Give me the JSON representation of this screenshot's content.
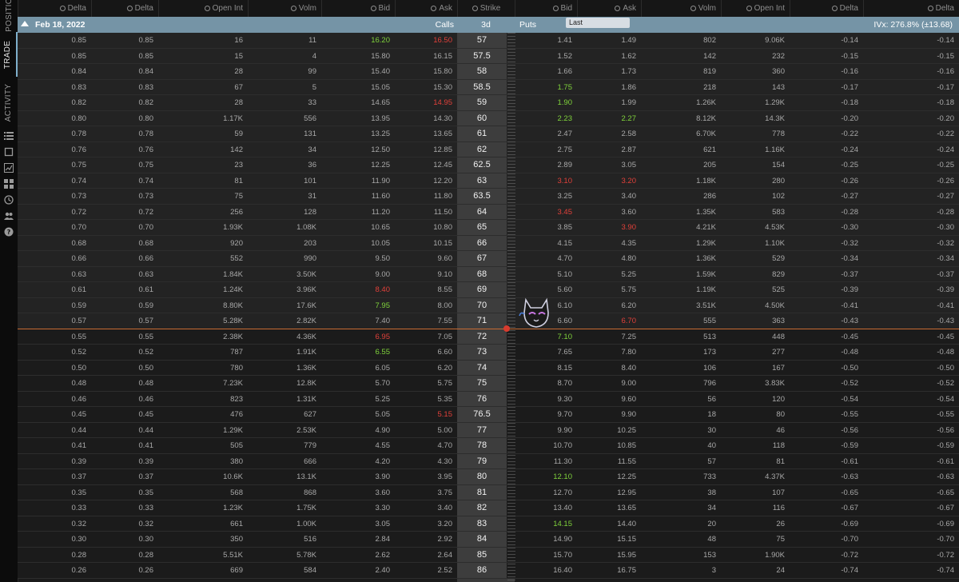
{
  "left_rail": {
    "tabs": [
      {
        "label": "POSITIO",
        "active": false
      },
      {
        "label": "TRADE",
        "active": true
      },
      {
        "label": "ACTIVITY",
        "active": false
      }
    ],
    "icons": [
      "list-icon",
      "square-icon",
      "chart-icon",
      "grid-icon",
      "clock-icon",
      "people-icon",
      "help-icon"
    ]
  },
  "header": {
    "call_columns": [
      "Delta",
      "Delta",
      "Open Int",
      "Volm",
      "Bid",
      "Ask"
    ],
    "strike_column": "Strike",
    "put_columns": [
      "Bid",
      "Ask",
      "Volm",
      "Open Int",
      "Delta",
      "Delta"
    ]
  },
  "series": {
    "date": "Feb 18, 2022",
    "calls_label": "Calls",
    "days_label": "3d",
    "puts_label": "Puts",
    "tooltip": "Last",
    "ivx": "IVx: 276.8% (±13.68)"
  },
  "colors": {
    "up": "#7fd23b",
    "down": "#e0403a",
    "series_bar": "#7594a6",
    "price_line": "#c86b33"
  },
  "rows": [
    {
      "call": [
        "0.85",
        "0.85",
        "16",
        "11",
        "16.20",
        "16.50"
      ],
      "strike": "57",
      "put": [
        "1.41",
        "1.49",
        "802",
        "9.06K",
        "-0.14",
        "-0.14"
      ],
      "call_colors": {
        "4": "up",
        "5": "down"
      },
      "put_colors": {},
      "itm": "call"
    },
    {
      "call": [
        "0.85",
        "0.85",
        "15",
        "4",
        "15.80",
        "16.15"
      ],
      "strike": "57.5",
      "put": [
        "1.52",
        "1.62",
        "142",
        "232",
        "-0.15",
        "-0.15"
      ],
      "call_colors": {},
      "put_colors": {},
      "itm": "call"
    },
    {
      "call": [
        "0.84",
        "0.84",
        "28",
        "99",
        "15.40",
        "15.80"
      ],
      "strike": "58",
      "put": [
        "1.66",
        "1.73",
        "819",
        "360",
        "-0.16",
        "-0.16"
      ],
      "call_colors": {},
      "put_colors": {},
      "itm": "call"
    },
    {
      "call": [
        "0.83",
        "0.83",
        "67",
        "5",
        "15.05",
        "15.30"
      ],
      "strike": "58.5",
      "put": [
        "1.75",
        "1.86",
        "218",
        "143",
        "-0.17",
        "-0.17"
      ],
      "call_colors": {},
      "put_colors": {
        "0": "up"
      },
      "itm": "call"
    },
    {
      "call": [
        "0.82",
        "0.82",
        "28",
        "33",
        "14.65",
        "14.95"
      ],
      "strike": "59",
      "put": [
        "1.90",
        "1.99",
        "1.26K",
        "1.29K",
        "-0.18",
        "-0.18"
      ],
      "call_colors": {
        "5": "down"
      },
      "put_colors": {
        "0": "up"
      },
      "itm": "call"
    },
    {
      "call": [
        "0.80",
        "0.80",
        "1.17K",
        "556",
        "13.95",
        "14.30"
      ],
      "strike": "60",
      "put": [
        "2.23",
        "2.27",
        "8.12K",
        "14.3K",
        "-0.20",
        "-0.20"
      ],
      "call_colors": {},
      "put_colors": {
        "0": "up",
        "1": "up"
      },
      "itm": "call"
    },
    {
      "call": [
        "0.78",
        "0.78",
        "59",
        "131",
        "13.25",
        "13.65"
      ],
      "strike": "61",
      "put": [
        "2.47",
        "2.58",
        "6.70K",
        "778",
        "-0.22",
        "-0.22"
      ],
      "call_colors": {},
      "put_colors": {},
      "itm": "call"
    },
    {
      "call": [
        "0.76",
        "0.76",
        "142",
        "34",
        "12.50",
        "12.85"
      ],
      "strike": "62",
      "put": [
        "2.75",
        "2.87",
        "621",
        "1.16K",
        "-0.24",
        "-0.24"
      ],
      "call_colors": {},
      "put_colors": {},
      "itm": "call"
    },
    {
      "call": [
        "0.75",
        "0.75",
        "23",
        "36",
        "12.25",
        "12.45"
      ],
      "strike": "62.5",
      "put": [
        "2.89",
        "3.05",
        "205",
        "154",
        "-0.25",
        "-0.25"
      ],
      "call_colors": {},
      "put_colors": {},
      "itm": "call"
    },
    {
      "call": [
        "0.74",
        "0.74",
        "81",
        "101",
        "11.90",
        "12.20"
      ],
      "strike": "63",
      "put": [
        "3.10",
        "3.20",
        "1.18K",
        "280",
        "-0.26",
        "-0.26"
      ],
      "call_colors": {},
      "put_colors": {
        "0": "down",
        "1": "down"
      },
      "itm": "call"
    },
    {
      "call": [
        "0.73",
        "0.73",
        "75",
        "31",
        "11.60",
        "11.80"
      ],
      "strike": "63.5",
      "put": [
        "3.25",
        "3.40",
        "286",
        "102",
        "-0.27",
        "-0.27"
      ],
      "call_colors": {},
      "put_colors": {},
      "itm": "call"
    },
    {
      "call": [
        "0.72",
        "0.72",
        "256",
        "128",
        "11.20",
        "11.50"
      ],
      "strike": "64",
      "put": [
        "3.45",
        "3.60",
        "1.35K",
        "583",
        "-0.28",
        "-0.28"
      ],
      "call_colors": {},
      "put_colors": {
        "0": "down"
      },
      "itm": "call"
    },
    {
      "call": [
        "0.70",
        "0.70",
        "1.93K",
        "1.08K",
        "10.65",
        "10.80"
      ],
      "strike": "65",
      "put": [
        "3.85",
        "3.90",
        "4.21K",
        "4.53K",
        "-0.30",
        "-0.30"
      ],
      "call_colors": {},
      "put_colors": {
        "1": "down"
      },
      "itm": "call"
    },
    {
      "call": [
        "0.68",
        "0.68",
        "920",
        "203",
        "10.05",
        "10.15"
      ],
      "strike": "66",
      "put": [
        "4.15",
        "4.35",
        "1.29K",
        "1.10K",
        "-0.32",
        "-0.32"
      ],
      "call_colors": {},
      "put_colors": {},
      "itm": "call"
    },
    {
      "call": [
        "0.66",
        "0.66",
        "552",
        "990",
        "9.50",
        "9.60"
      ],
      "strike": "67",
      "put": [
        "4.70",
        "4.80",
        "1.36K",
        "529",
        "-0.34",
        "-0.34"
      ],
      "call_colors": {},
      "put_colors": {},
      "itm": "call"
    },
    {
      "call": [
        "0.63",
        "0.63",
        "1.84K",
        "3.50K",
        "9.00",
        "9.10"
      ],
      "strike": "68",
      "put": [
        "5.10",
        "5.25",
        "1.59K",
        "829",
        "-0.37",
        "-0.37"
      ],
      "call_colors": {},
      "put_colors": {},
      "itm": "call"
    },
    {
      "call": [
        "0.61",
        "0.61",
        "1.24K",
        "3.96K",
        "8.40",
        "8.55"
      ],
      "strike": "69",
      "put": [
        "5.60",
        "5.75",
        "1.19K",
        "525",
        "-0.39",
        "-0.39"
      ],
      "call_colors": {
        "4": "down"
      },
      "put_colors": {},
      "itm": "call"
    },
    {
      "call": [
        "0.59",
        "0.59",
        "8.80K",
        "17.6K",
        "7.95",
        "8.00"
      ],
      "strike": "70",
      "put": [
        "6.10",
        "6.20",
        "3.51K",
        "4.50K",
        "-0.41",
        "-0.41"
      ],
      "call_colors": {
        "4": "up"
      },
      "put_colors": {},
      "itm": "call"
    },
    {
      "call": [
        "0.57",
        "0.57",
        "5.28K",
        "2.82K",
        "7.40",
        "7.55"
      ],
      "strike": "71",
      "put": [
        "6.60",
        "6.70",
        "555",
        "363",
        "-0.43",
        "-0.43"
      ],
      "call_colors": {},
      "put_colors": {
        "1": "down"
      },
      "itm": "call"
    },
    {
      "call": [
        "0.55",
        "0.55",
        "2.38K",
        "4.36K",
        "6.95",
        "7.05"
      ],
      "strike": "72",
      "put": [
        "7.10",
        "7.25",
        "513",
        "448",
        "-0.45",
        "-0.45"
      ],
      "call_colors": {
        "4": "down"
      },
      "put_colors": {
        "0": "up"
      },
      "itm": "put"
    },
    {
      "call": [
        "0.52",
        "0.52",
        "787",
        "1.91K",
        "6.55",
        "6.60"
      ],
      "strike": "73",
      "put": [
        "7.65",
        "7.80",
        "173",
        "277",
        "-0.48",
        "-0.48"
      ],
      "call_colors": {
        "4": "up"
      },
      "put_colors": {},
      "itm": "put"
    },
    {
      "call": [
        "0.50",
        "0.50",
        "780",
        "1.36K",
        "6.05",
        "6.20"
      ],
      "strike": "74",
      "put": [
        "8.15",
        "8.40",
        "106",
        "167",
        "-0.50",
        "-0.50"
      ],
      "call_colors": {},
      "put_colors": {},
      "itm": "put"
    },
    {
      "call": [
        "0.48",
        "0.48",
        "7.23K",
        "12.8K",
        "5.70",
        "5.75"
      ],
      "strike": "75",
      "put": [
        "8.70",
        "9.00",
        "796",
        "3.83K",
        "-0.52",
        "-0.52"
      ],
      "call_colors": {},
      "put_colors": {},
      "itm": "put"
    },
    {
      "call": [
        "0.46",
        "0.46",
        "823",
        "1.31K",
        "5.25",
        "5.35"
      ],
      "strike": "76",
      "put": [
        "9.30",
        "9.60",
        "56",
        "120",
        "-0.54",
        "-0.54"
      ],
      "call_colors": {},
      "put_colors": {},
      "itm": "put"
    },
    {
      "call": [
        "0.45",
        "0.45",
        "476",
        "627",
        "5.05",
        "5.15"
      ],
      "strike": "76.5",
      "put": [
        "9.70",
        "9.90",
        "18",
        "80",
        "-0.55",
        "-0.55"
      ],
      "call_colors": {
        "5": "down"
      },
      "put_colors": {},
      "itm": "put"
    },
    {
      "call": [
        "0.44",
        "0.44",
        "1.29K",
        "2.53K",
        "4.90",
        "5.00"
      ],
      "strike": "77",
      "put": [
        "9.90",
        "10.25",
        "30",
        "46",
        "-0.56",
        "-0.56"
      ],
      "call_colors": {},
      "put_colors": {},
      "itm": "put"
    },
    {
      "call": [
        "0.41",
        "0.41",
        "505",
        "779",
        "4.55",
        "4.70"
      ],
      "strike": "78",
      "put": [
        "10.70",
        "10.85",
        "40",
        "118",
        "-0.59",
        "-0.59"
      ],
      "call_colors": {},
      "put_colors": {},
      "itm": "put"
    },
    {
      "call": [
        "0.39",
        "0.39",
        "380",
        "666",
        "4.20",
        "4.30"
      ],
      "strike": "79",
      "put": [
        "11.30",
        "11.55",
        "57",
        "81",
        "-0.61",
        "-0.61"
      ],
      "call_colors": {},
      "put_colors": {},
      "itm": "put"
    },
    {
      "call": [
        "0.37",
        "0.37",
        "10.6K",
        "13.1K",
        "3.90",
        "3.95"
      ],
      "strike": "80",
      "put": [
        "12.10",
        "12.25",
        "733",
        "4.37K",
        "-0.63",
        "-0.63"
      ],
      "call_colors": {},
      "put_colors": {
        "0": "up"
      },
      "itm": "put"
    },
    {
      "call": [
        "0.35",
        "0.35",
        "568",
        "868",
        "3.60",
        "3.75"
      ],
      "strike": "81",
      "put": [
        "12.70",
        "12.95",
        "38",
        "107",
        "-0.65",
        "-0.65"
      ],
      "call_colors": {},
      "put_colors": {},
      "itm": "put"
    },
    {
      "call": [
        "0.33",
        "0.33",
        "1.23K",
        "1.75K",
        "3.30",
        "3.40"
      ],
      "strike": "82",
      "put": [
        "13.40",
        "13.65",
        "34",
        "116",
        "-0.67",
        "-0.67"
      ],
      "call_colors": {},
      "put_colors": {},
      "itm": "put"
    },
    {
      "call": [
        "0.32",
        "0.32",
        "661",
        "1.00K",
        "3.05",
        "3.20"
      ],
      "strike": "83",
      "put": [
        "14.15",
        "14.40",
        "20",
        "26",
        "-0.69",
        "-0.69"
      ],
      "call_colors": {},
      "put_colors": {
        "0": "up"
      },
      "itm": "put"
    },
    {
      "call": [
        "0.30",
        "0.30",
        "350",
        "516",
        "2.84",
        "2.92"
      ],
      "strike": "84",
      "put": [
        "14.90",
        "15.15",
        "48",
        "75",
        "-0.70",
        "-0.70"
      ],
      "call_colors": {},
      "put_colors": {},
      "itm": "put"
    },
    {
      "call": [
        "0.28",
        "0.28",
        "5.51K",
        "5.78K",
        "2.62",
        "2.64"
      ],
      "strike": "85",
      "put": [
        "15.70",
        "15.95",
        "153",
        "1.90K",
        "-0.72",
        "-0.72"
      ],
      "call_colors": {},
      "put_colors": {},
      "itm": "put"
    },
    {
      "call": [
        "0.26",
        "0.26",
        "669",
        "584",
        "2.40",
        "2.52"
      ],
      "strike": "86",
      "put": [
        "16.40",
        "16.75",
        "3",
        "24",
        "-0.74",
        "-0.74"
      ],
      "call_colors": {},
      "put_colors": {},
      "itm": "put"
    }
  ]
}
